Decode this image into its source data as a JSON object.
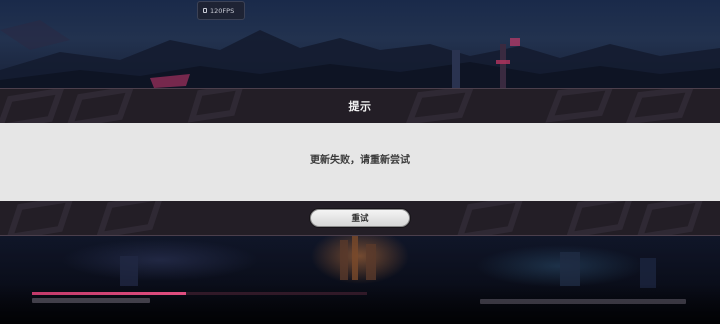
{
  "fps_badge": {
    "label": "120FPS",
    "icon": "screen-icon"
  },
  "dialog": {
    "title": "提示",
    "message": "更新失败，请重新尝试",
    "retry_label": "重试"
  },
  "loading": {
    "progress": 0.46
  },
  "colors": {
    "accent": "#e04e80",
    "dialog_band": "#231e26",
    "dialog_body": "#e6e6e6"
  }
}
